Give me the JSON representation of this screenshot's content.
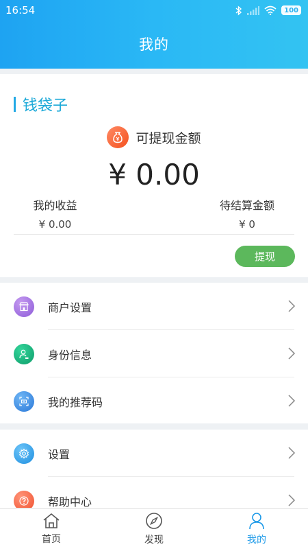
{
  "status_bar": {
    "time": "16:54",
    "battery": "100"
  },
  "header": {
    "title": "我的"
  },
  "wallet": {
    "heading": "钱袋子",
    "withdrawable_label": "可提现金额",
    "amount": "¥ 0.00",
    "earnings_label": "我的收益",
    "earnings_value": "¥ 0.00",
    "pending_label": "待结算金额",
    "pending_value": "¥ 0",
    "withdraw_button": "提现"
  },
  "menu": {
    "group1": [
      {
        "label": "商户设置",
        "icon": "shop-icon",
        "color": "#9c6ade"
      },
      {
        "label": "身份信息",
        "icon": "id-card-icon",
        "color": "#1bb87a"
      },
      {
        "label": "我的推荐码",
        "icon": "qr-code-icon",
        "color": "#3a8ee6"
      }
    ],
    "group2": [
      {
        "label": "设置",
        "icon": "gear-icon",
        "color": "#2ea6f0"
      },
      {
        "label": "帮助中心",
        "icon": "help-icon",
        "color": "#ff6a4d"
      }
    ]
  },
  "tabbar": {
    "items": [
      {
        "label": "首页",
        "icon": "home-icon"
      },
      {
        "label": "发现",
        "icon": "compass-icon"
      },
      {
        "label": "我的",
        "icon": "user-icon"
      }
    ],
    "active_index": 2,
    "active_color": "#1e9ae8"
  }
}
